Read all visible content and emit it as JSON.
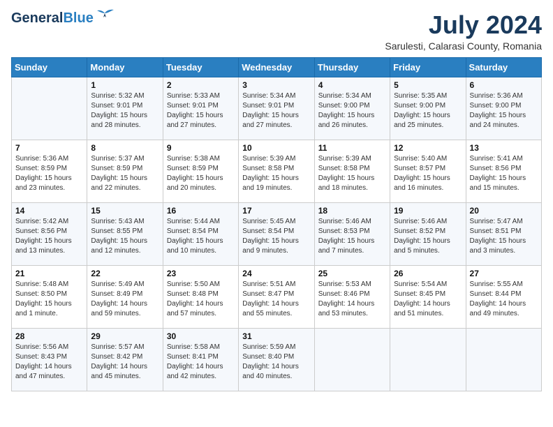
{
  "header": {
    "logo_line1": "General",
    "logo_line2": "Blue",
    "title": "July 2024",
    "subtitle": "Sarulesti, Calarasi County, Romania"
  },
  "weekdays": [
    "Sunday",
    "Monday",
    "Tuesday",
    "Wednesday",
    "Thursday",
    "Friday",
    "Saturday"
  ],
  "weeks": [
    [
      {
        "day": "",
        "info": ""
      },
      {
        "day": "1",
        "info": "Sunrise: 5:32 AM\nSunset: 9:01 PM\nDaylight: 15 hours\nand 28 minutes."
      },
      {
        "day": "2",
        "info": "Sunrise: 5:33 AM\nSunset: 9:01 PM\nDaylight: 15 hours\nand 27 minutes."
      },
      {
        "day": "3",
        "info": "Sunrise: 5:34 AM\nSunset: 9:01 PM\nDaylight: 15 hours\nand 27 minutes."
      },
      {
        "day": "4",
        "info": "Sunrise: 5:34 AM\nSunset: 9:00 PM\nDaylight: 15 hours\nand 26 minutes."
      },
      {
        "day": "5",
        "info": "Sunrise: 5:35 AM\nSunset: 9:00 PM\nDaylight: 15 hours\nand 25 minutes."
      },
      {
        "day": "6",
        "info": "Sunrise: 5:36 AM\nSunset: 9:00 PM\nDaylight: 15 hours\nand 24 minutes."
      }
    ],
    [
      {
        "day": "7",
        "info": "Sunrise: 5:36 AM\nSunset: 8:59 PM\nDaylight: 15 hours\nand 23 minutes."
      },
      {
        "day": "8",
        "info": "Sunrise: 5:37 AM\nSunset: 8:59 PM\nDaylight: 15 hours\nand 22 minutes."
      },
      {
        "day": "9",
        "info": "Sunrise: 5:38 AM\nSunset: 8:59 PM\nDaylight: 15 hours\nand 20 minutes."
      },
      {
        "day": "10",
        "info": "Sunrise: 5:39 AM\nSunset: 8:58 PM\nDaylight: 15 hours\nand 19 minutes."
      },
      {
        "day": "11",
        "info": "Sunrise: 5:39 AM\nSunset: 8:58 PM\nDaylight: 15 hours\nand 18 minutes."
      },
      {
        "day": "12",
        "info": "Sunrise: 5:40 AM\nSunset: 8:57 PM\nDaylight: 15 hours\nand 16 minutes."
      },
      {
        "day": "13",
        "info": "Sunrise: 5:41 AM\nSunset: 8:56 PM\nDaylight: 15 hours\nand 15 minutes."
      }
    ],
    [
      {
        "day": "14",
        "info": "Sunrise: 5:42 AM\nSunset: 8:56 PM\nDaylight: 15 hours\nand 13 minutes."
      },
      {
        "day": "15",
        "info": "Sunrise: 5:43 AM\nSunset: 8:55 PM\nDaylight: 15 hours\nand 12 minutes."
      },
      {
        "day": "16",
        "info": "Sunrise: 5:44 AM\nSunset: 8:54 PM\nDaylight: 15 hours\nand 10 minutes."
      },
      {
        "day": "17",
        "info": "Sunrise: 5:45 AM\nSunset: 8:54 PM\nDaylight: 15 hours\nand 9 minutes."
      },
      {
        "day": "18",
        "info": "Sunrise: 5:46 AM\nSunset: 8:53 PM\nDaylight: 15 hours\nand 7 minutes."
      },
      {
        "day": "19",
        "info": "Sunrise: 5:46 AM\nSunset: 8:52 PM\nDaylight: 15 hours\nand 5 minutes."
      },
      {
        "day": "20",
        "info": "Sunrise: 5:47 AM\nSunset: 8:51 PM\nDaylight: 15 hours\nand 3 minutes."
      }
    ],
    [
      {
        "day": "21",
        "info": "Sunrise: 5:48 AM\nSunset: 8:50 PM\nDaylight: 15 hours\nand 1 minute."
      },
      {
        "day": "22",
        "info": "Sunrise: 5:49 AM\nSunset: 8:49 PM\nDaylight: 14 hours\nand 59 minutes."
      },
      {
        "day": "23",
        "info": "Sunrise: 5:50 AM\nSunset: 8:48 PM\nDaylight: 14 hours\nand 57 minutes."
      },
      {
        "day": "24",
        "info": "Sunrise: 5:51 AM\nSunset: 8:47 PM\nDaylight: 14 hours\nand 55 minutes."
      },
      {
        "day": "25",
        "info": "Sunrise: 5:53 AM\nSunset: 8:46 PM\nDaylight: 14 hours\nand 53 minutes."
      },
      {
        "day": "26",
        "info": "Sunrise: 5:54 AM\nSunset: 8:45 PM\nDaylight: 14 hours\nand 51 minutes."
      },
      {
        "day": "27",
        "info": "Sunrise: 5:55 AM\nSunset: 8:44 PM\nDaylight: 14 hours\nand 49 minutes."
      }
    ],
    [
      {
        "day": "28",
        "info": "Sunrise: 5:56 AM\nSunset: 8:43 PM\nDaylight: 14 hours\nand 47 minutes."
      },
      {
        "day": "29",
        "info": "Sunrise: 5:57 AM\nSunset: 8:42 PM\nDaylight: 14 hours\nand 45 minutes."
      },
      {
        "day": "30",
        "info": "Sunrise: 5:58 AM\nSunset: 8:41 PM\nDaylight: 14 hours\nand 42 minutes."
      },
      {
        "day": "31",
        "info": "Sunrise: 5:59 AM\nSunset: 8:40 PM\nDaylight: 14 hours\nand 40 minutes."
      },
      {
        "day": "",
        "info": ""
      },
      {
        "day": "",
        "info": ""
      },
      {
        "day": "",
        "info": ""
      }
    ]
  ]
}
